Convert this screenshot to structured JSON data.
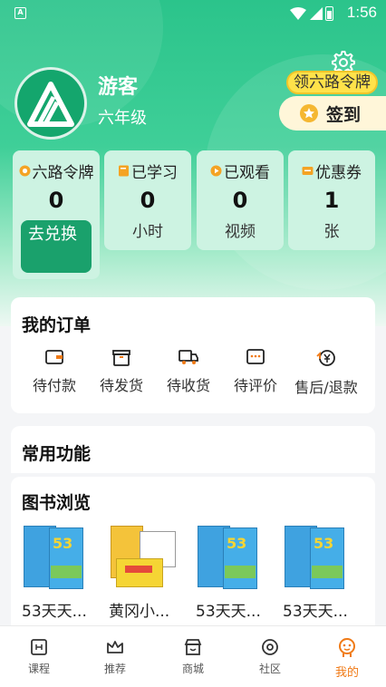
{
  "status_bar": {
    "app_badge": "A",
    "time": "1:56"
  },
  "profile": {
    "name": "游客",
    "grade": "六年级",
    "token_tag": "领六路令牌",
    "checkin_label": "签到"
  },
  "stats": [
    {
      "title": "六路令牌",
      "value": "0",
      "action": "去兑换",
      "icon": "token-icon"
    },
    {
      "title": "已学习",
      "value": "0",
      "unit": "小时",
      "icon": "book-icon"
    },
    {
      "title": "已观看",
      "value": "0",
      "unit": "视频",
      "icon": "play-icon"
    },
    {
      "title": "优惠券",
      "value": "1",
      "unit": "张",
      "icon": "coupon-icon"
    }
  ],
  "orders": {
    "title": "我的订单",
    "items": [
      {
        "label": "待付款",
        "icon": "wallet-icon"
      },
      {
        "label": "待发货",
        "icon": "box-icon"
      },
      {
        "label": "待收货",
        "icon": "truck-icon"
      },
      {
        "label": "待评价",
        "icon": "comment-icon"
      },
      {
        "label": "售后/退款",
        "icon": "refund-icon"
      }
    ]
  },
  "functions": {
    "title": "常用功能"
  },
  "books": {
    "title": "图书浏览",
    "items": [
      {
        "name": "53天天..."
      },
      {
        "name": "黄冈小..."
      },
      {
        "name": "53天天..."
      },
      {
        "name": "53天天..."
      }
    ]
  },
  "nav": [
    {
      "label": "课程",
      "icon": "course-icon"
    },
    {
      "label": "推荐",
      "icon": "crown-icon"
    },
    {
      "label": "商城",
      "icon": "shop-icon"
    },
    {
      "label": "社区",
      "icon": "community-icon"
    },
    {
      "label": "我的",
      "icon": "mine-icon",
      "active": true
    }
  ],
  "colors": {
    "brand_green": "#2bc48b",
    "accent_orange": "#f07a16",
    "token_yellow": "#ffe24a"
  }
}
